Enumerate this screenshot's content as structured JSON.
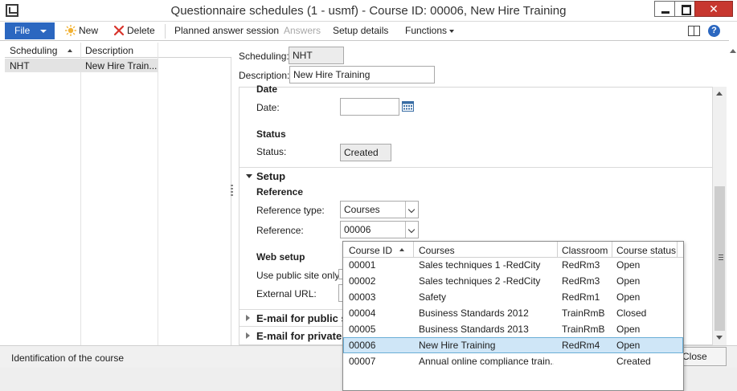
{
  "window": {
    "title": "Questionnaire schedules (1 - usmf) - Course ID: 00006, New Hire Training",
    "close_glyph": "✕"
  },
  "ribbon": {
    "file_label": "File",
    "new_label": "New",
    "delete_label": "Delete",
    "planned_label": "Planned answer session",
    "answers_label": "Answers",
    "setup_details_label": "Setup details",
    "functions_label": "Functions",
    "help_glyph": "?"
  },
  "grid": {
    "columns": [
      "Scheduling",
      "Description"
    ],
    "rows": [
      {
        "scheduling": "NHT",
        "description": "New Hire Train..."
      }
    ]
  },
  "header_fields": {
    "scheduling_label": "Scheduling:",
    "scheduling_value": "NHT",
    "description_label": "Description:",
    "description_value": "New Hire Training"
  },
  "date_section": {
    "title": "Date",
    "date_label": "Date:",
    "date_value": ""
  },
  "status_section": {
    "title": "Status",
    "status_label": "Status:",
    "status_value": "Created"
  },
  "setup": {
    "title": "Setup",
    "reference_title": "Reference",
    "reference_type_label": "Reference type:",
    "reference_type_value": "Courses",
    "reference_label": "Reference:",
    "reference_value": "00006",
    "web_setup_title": "Web setup",
    "use_public_label": "Use public site only?",
    "external_url_label": "External URL:"
  },
  "collapsed_sections": [
    {
      "label": "E-mail for public s"
    },
    {
      "label": "E-mail for private"
    }
  ],
  "lookup": {
    "columns": [
      "Course ID",
      "Courses",
      "Classroom",
      "Course status"
    ],
    "rows": [
      {
        "id": "00001",
        "course": "Sales techniques 1 -RedCity",
        "classroom": "RedRm3",
        "status": "Open"
      },
      {
        "id": "00002",
        "course": "Sales techniques 2 -RedCity",
        "classroom": "RedRm3",
        "status": "Open"
      },
      {
        "id": "00003",
        "course": "Safety",
        "classroom": "RedRm1",
        "status": "Open"
      },
      {
        "id": "00004",
        "course": "Business Standards 2012",
        "classroom": "TrainRmB",
        "status": "Closed"
      },
      {
        "id": "00005",
        "course": "Business Standards 2013",
        "classroom": "TrainRmB",
        "status": "Open"
      },
      {
        "id": "00006",
        "course": "New Hire Training",
        "classroom": "RedRm4",
        "status": "Open"
      },
      {
        "id": "00007",
        "course": "Annual online compliance train...",
        "classroom": "",
        "status": "Created"
      }
    ],
    "selected_index": 5
  },
  "status_bar": {
    "text": "Identification of the course",
    "close_label": "Close"
  }
}
